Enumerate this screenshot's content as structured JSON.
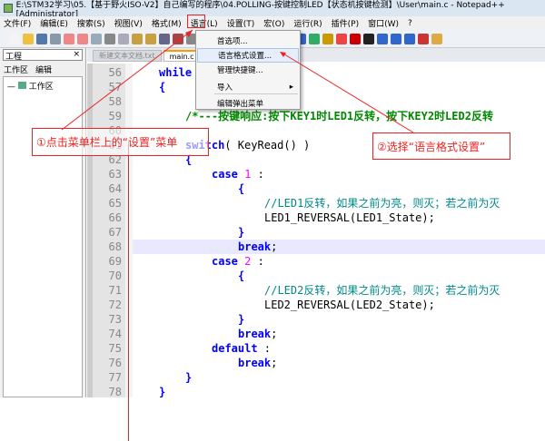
{
  "window": {
    "title": "E:\\STM32学习\\05.【基于野火ISO-V2】自己编写的程序\\04.POLLING-按键控制LED【状态机按键检测】\\User\\main.c - Notepad++ [Administrator]"
  },
  "menu": [
    "文件(F)",
    "编辑(E)",
    "搜索(S)",
    "视图(V)",
    "格式(M)",
    "语言(L)",
    "设置(T)",
    "宏(O)",
    "运行(R)",
    "插件(P)",
    "窗口(W)",
    "?"
  ],
  "dropdown": [
    "首选项...",
    "语言格式设置...",
    "管理快捷键...",
    "导入",
    "编辑弹出菜单"
  ],
  "left_panel": {
    "title": "工程",
    "close": "×",
    "tabs": [
      "工作区",
      "编辑"
    ],
    "tree_item": "工作区"
  },
  "tabs": [
    "新建文本文档.txt",
    "main.c"
  ],
  "lines": [
    {
      "n": "56",
      "i": 1,
      "t": [
        [
          "kw",
          "while"
        ]
      ]
    },
    {
      "n": "57",
      "i": 1,
      "t": [
        [
          "kw",
          "{"
        ]
      ]
    },
    {
      "n": "58",
      "i": 0,
      "t": []
    },
    {
      "n": "59",
      "i": 2,
      "t": [
        [
          "cm",
          "/*---按键响应:按下KEY1时LED1反转，按下KEY2时LED2反转"
        ]
      ]
    },
    {
      "n": "60",
      "i": 0,
      "t": []
    },
    {
      "n": "61",
      "i": 2,
      "t": [
        [
          "kw",
          "switch"
        ],
        [
          "",
          "( KeyRead() )"
        ]
      ]
    },
    {
      "n": "62",
      "i": 2,
      "t": [
        [
          "kw",
          "{"
        ]
      ]
    },
    {
      "n": "63",
      "i": 3,
      "t": [
        [
          "kw",
          "case "
        ],
        [
          "num",
          "1"
        ],
        [
          "",
          " :"
        ]
      ]
    },
    {
      "n": "64",
      "i": 4,
      "t": [
        [
          "kw",
          "{"
        ]
      ]
    },
    {
      "n": "65",
      "i": 5,
      "t": [
        [
          "cm2",
          "//LED1反转，如果之前为亮，则灭；若之前为灭"
        ]
      ]
    },
    {
      "n": "66",
      "i": 5,
      "t": [
        [
          "",
          "LED1_REVERSAL(LED1_State);"
        ]
      ]
    },
    {
      "n": "67",
      "i": 4,
      "t": [
        [
          "kw",
          "}"
        ]
      ]
    },
    {
      "n": "68",
      "i": 4,
      "t": [
        [
          "kw",
          "break"
        ],
        [
          "",
          ";"
        ]
      ]
    },
    {
      "n": "69",
      "i": 3,
      "t": [
        [
          "kw",
          "case "
        ],
        [
          "num",
          "2"
        ],
        [
          "",
          " :"
        ]
      ]
    },
    {
      "n": "70",
      "i": 4,
      "t": [
        [
          "kw",
          "{"
        ]
      ]
    },
    {
      "n": "71",
      "i": 5,
      "t": [
        [
          "cm2",
          "//LED2反转，如果之前为亮，则灭；若之前为灭"
        ]
      ]
    },
    {
      "n": "72",
      "i": 5,
      "t": [
        [
          "",
          "LED2_REVERSAL(LED2_State);"
        ]
      ]
    },
    {
      "n": "73",
      "i": 4,
      "t": [
        [
          "kw",
          "}"
        ]
      ]
    },
    {
      "n": "74",
      "i": 4,
      "t": [
        [
          "kw",
          "break"
        ],
        [
          "",
          ";"
        ]
      ]
    },
    {
      "n": "75",
      "i": 3,
      "t": [
        [
          "kw",
          "default"
        ],
        [
          "",
          " :"
        ]
      ]
    },
    {
      "n": "76",
      "i": 4,
      "t": [
        [
          "kw",
          "break"
        ],
        [
          "",
          ";"
        ]
      ]
    },
    {
      "n": "77",
      "i": 2,
      "t": [
        [
          "kw",
          "}"
        ]
      ]
    },
    {
      "n": "78",
      "i": 1,
      "t": [
        [
          "kw",
          "}"
        ]
      ]
    }
  ],
  "annotations": {
    "step1": "①点击菜单栏上的“设置”菜单",
    "step2": "②选择“语言格式设置”"
  },
  "colors": {
    "annotation": "#ee2222",
    "keyword": "#0000ff",
    "comment": "#008800"
  }
}
